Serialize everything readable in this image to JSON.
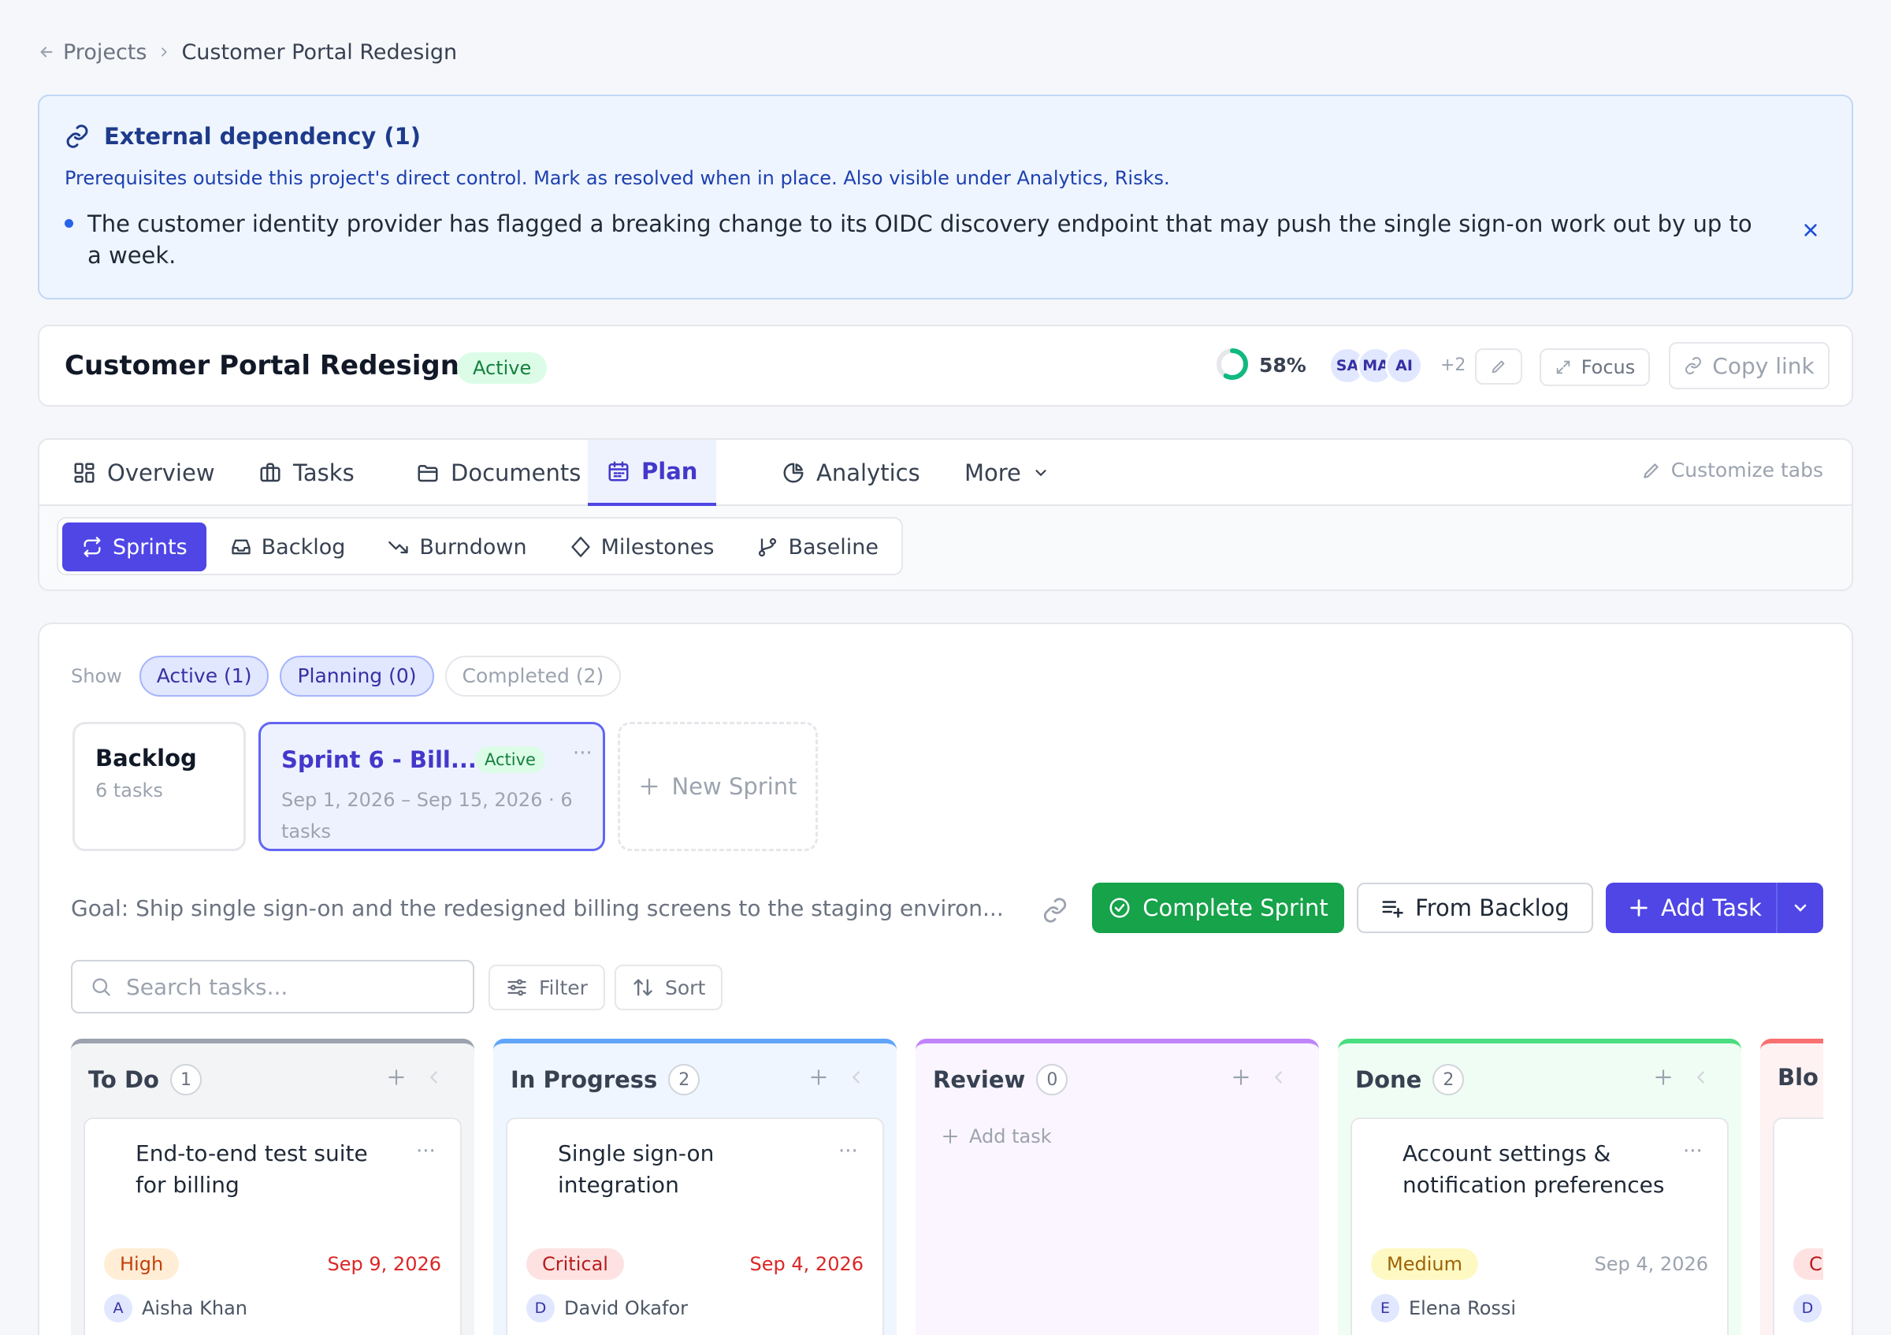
{
  "breadcrumb": {
    "back": "Projects",
    "current": "Customer Portal Redesign"
  },
  "alert": {
    "title": "External dependency (1)",
    "description": "Prerequisites outside this project's direct control. Mark as resolved when in place. Also visible under Analytics, Risks.",
    "item": "The customer identity provider has flagged a breaking change to its OIDC discovery endpoint that may push the single sign-on work out by up to a week."
  },
  "project": {
    "title": "Customer Portal Redesign",
    "status": "Active",
    "progress_percent": 58,
    "progress_label": "58%",
    "avatars": [
      "SA",
      "MA",
      "AI"
    ],
    "avatars_more": "+2",
    "focus_label": "Focus",
    "copy_label": "Copy link"
  },
  "tabs": [
    {
      "label": "Overview",
      "icon": "dashboard-icon"
    },
    {
      "label": "Tasks",
      "icon": "briefcase-icon"
    },
    {
      "label": "Documents",
      "icon": "folder-icon"
    },
    {
      "label": "Plan",
      "icon": "calendar-icon",
      "active": true
    },
    {
      "label": "Analytics",
      "icon": "pie-chart-icon"
    },
    {
      "label": "More",
      "icon": "chevron-down-icon"
    }
  ],
  "customize_tabs": "Customize tabs",
  "subtabs": [
    {
      "label": "Sprints",
      "icon": "repeat-icon",
      "active": true
    },
    {
      "label": "Backlog",
      "icon": "inbox-icon"
    },
    {
      "label": "Burndown",
      "icon": "trending-down-icon"
    },
    {
      "label": "Milestones",
      "icon": "diamond-icon"
    },
    {
      "label": "Baseline",
      "icon": "git-branch-icon"
    }
  ],
  "show": {
    "label": "Show",
    "filters": [
      "Active (1)",
      "Planning (0)",
      "Completed (2)"
    ]
  },
  "sprints": {
    "backlog": {
      "title": "Backlog",
      "subtitle": "6 tasks"
    },
    "current": {
      "title": "Sprint 6 - Bill...",
      "badge": "Active",
      "menu": "···",
      "subtitle": "Sep 1, 2026 – Sep 15, 2026 · 6 tasks"
    },
    "new_label": "New Sprint"
  },
  "goal": "Goal: Ship single sign-on and the redesigned billing screens to the staging environ...",
  "actions": {
    "complete": "Complete Sprint",
    "from_backlog": "From Backlog",
    "add_task": "Add Task"
  },
  "search": {
    "placeholder": "Search tasks..."
  },
  "filter_label": "Filter",
  "sort_label": "Sort",
  "colors": {
    "todo": "#9ca3af",
    "progress": "#60a5fa",
    "review": "#c084fc",
    "done": "#4ade80",
    "blocked": "#f87171",
    "accent": "#4f46e5",
    "success": "#16a34a"
  },
  "columns": [
    {
      "name": "To Do",
      "count": "1",
      "card": {
        "title": "End-to-end test suite for billing",
        "priority": "High",
        "due": "Sep 9, 2026",
        "initial": "A",
        "assignee": "Aisha Khan"
      }
    },
    {
      "name": "In Progress",
      "count": "2",
      "card": {
        "title": "Single sign-on integration",
        "priority": "Critical",
        "due": "Sep 4, 2026",
        "initial": "D",
        "assignee": "David Okafor"
      }
    },
    {
      "name": "Review",
      "count": "0",
      "add_task": "Add task"
    },
    {
      "name": "Done",
      "count": "2",
      "card": {
        "title": "Account settings & notification preferences",
        "priority": "Medium",
        "due": "Sep 4, 2026",
        "initial": "E",
        "assignee": "Elena Rossi"
      }
    },
    {
      "name": "Blo",
      "count": "",
      "card": {
        "priority": "C",
        "initial": "D"
      }
    }
  ]
}
